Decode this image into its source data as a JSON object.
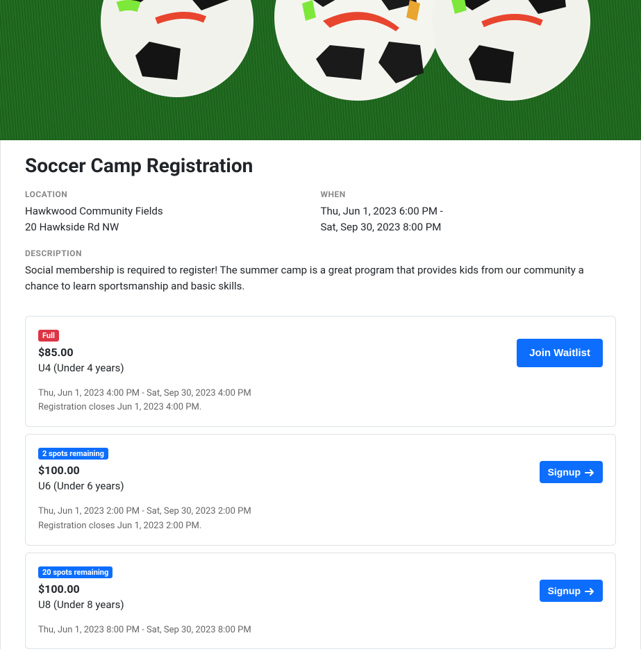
{
  "title": "Soccer Camp Registration",
  "location": {
    "label": "LOCATION",
    "name": "Hawkwood Community Fields",
    "address": "20 Hawkside Rd NW"
  },
  "when": {
    "label": "WHEN",
    "line1": "Thu, Jun 1, 2023 6:00 PM -",
    "line2": "Sat, Sep 30, 2023 8:00 PM"
  },
  "description": {
    "label": "DESCRIPTION",
    "text": "Social membership is required to register! The summer camp is a great program that provides kids from our community a chance to learn sportsmanship and basic skills."
  },
  "sessions": [
    {
      "badge": "Full",
      "badge_type": "full",
      "price": "$85.00",
      "name": "U4 (Under 4 years)",
      "schedule": "Thu, Jun 1, 2023 4:00 PM - Sat, Sep 30, 2023 4:00 PM",
      "reg_closes": "Registration closes Jun 1, 2023 4:00 PM.",
      "button_label": "Join Waitlist",
      "button_type": "waitlist"
    },
    {
      "badge": "2 spots remaining",
      "badge_type": "spots",
      "price": "$100.00",
      "name": "U6 (Under 6 years)",
      "schedule": "Thu, Jun 1, 2023 2:00 PM - Sat, Sep 30, 2023 2:00 PM",
      "reg_closes": "Registration closes Jun 1, 2023 2:00 PM.",
      "button_label": "Signup",
      "button_type": "signup"
    },
    {
      "badge": "20 spots remaining",
      "badge_type": "spots",
      "price": "$100.00",
      "name": "U8 (Under 8 years)",
      "schedule": "Thu, Jun 1, 2023 8:00 PM - Sat, Sep 30, 2023 8:00 PM",
      "reg_closes": "",
      "button_label": "Signup",
      "button_type": "signup"
    }
  ]
}
